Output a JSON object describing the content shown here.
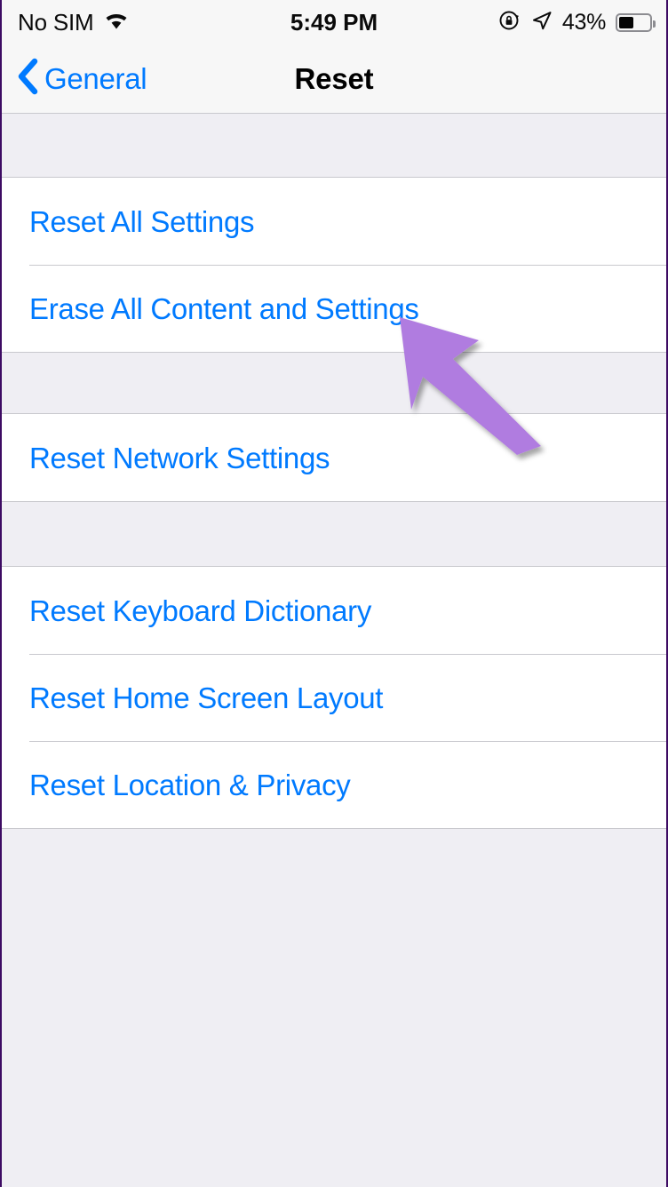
{
  "status_bar": {
    "carrier": "No SIM",
    "wifi_icon": "wifi-icon",
    "time": "5:49 PM",
    "rotation_lock_icon": "rotation-lock-icon",
    "location_icon": "location-arrow-icon",
    "battery_percent": "43%",
    "battery_level": 43
  },
  "nav_bar": {
    "back_icon": "chevron-left-icon",
    "back_label": "General",
    "title": "Reset"
  },
  "sections": [
    {
      "rows": [
        {
          "label": "Reset All Settings"
        },
        {
          "label": "Erase All Content and Settings"
        }
      ]
    },
    {
      "rows": [
        {
          "label": "Reset Network Settings"
        }
      ]
    },
    {
      "rows": [
        {
          "label": "Reset Keyboard Dictionary"
        },
        {
          "label": "Reset Home Screen Layout"
        },
        {
          "label": "Reset Location & Privacy"
        }
      ]
    }
  ],
  "annotation": {
    "type": "arrow-pointer",
    "color": "#B07CE0",
    "points_to": "Erase All Content and Settings"
  },
  "colors": {
    "accent_blue": "#007AFF",
    "group_background": "#FFFFFF",
    "page_background": "#EFEEF3",
    "bar_background": "#F7F7F7",
    "separator": "#C9C9CE",
    "annotation_purple": "#B07CE0"
  }
}
